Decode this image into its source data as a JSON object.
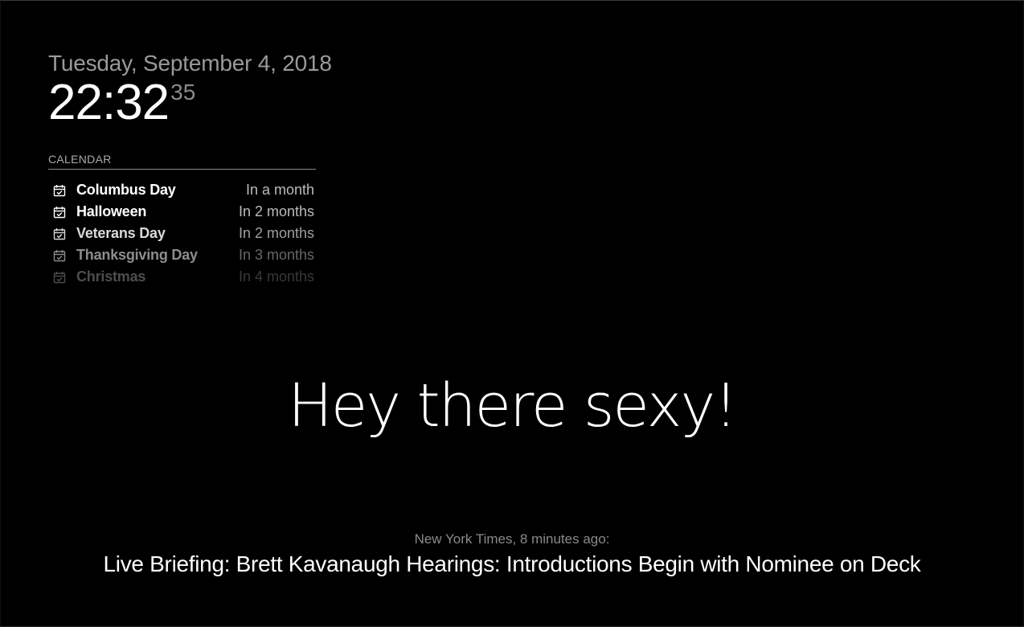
{
  "clock": {
    "date": "Tuesday, September 4, 2018",
    "hours_minutes": "22:32",
    "seconds": "35"
  },
  "calendar": {
    "header": "CALENDAR",
    "icon": "calendar-check-icon",
    "events": [
      {
        "title": "Columbus Day",
        "when": "In a month"
      },
      {
        "title": "Halloween",
        "when": "In 2 months"
      },
      {
        "title": "Veterans Day",
        "when": "In 2 months"
      },
      {
        "title": "Thanksgiving Day",
        "when": "In 3 months"
      },
      {
        "title": "Christmas",
        "when": "In 4 months"
      }
    ]
  },
  "compliment": {
    "text": "Hey there sexy!"
  },
  "news": {
    "source": "New York Times, 8 minutes ago:",
    "headline": "Live Briefing: Brett Kavanaugh Hearings: Introductions Begin with Nominee on Deck"
  }
}
